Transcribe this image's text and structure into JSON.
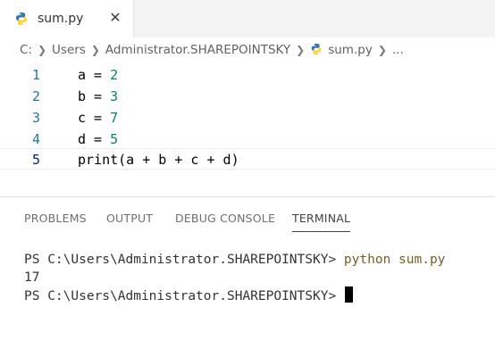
{
  "editor_tab": {
    "filename": "sum.py",
    "icon": "python-icon",
    "close_glyph": "✕"
  },
  "breadcrumb": {
    "parts": [
      "C:",
      "Users",
      "Administrator.SHAREPOINTSKY",
      "sum.py",
      "..."
    ]
  },
  "code": {
    "lines": [
      {
        "number": "1",
        "var": "a",
        "op": " = ",
        "value": "2"
      },
      {
        "number": "2",
        "var": "b",
        "op": " = ",
        "value": "3"
      },
      {
        "number": "3",
        "var": "c",
        "op": " = ",
        "value": "7"
      },
      {
        "number": "4",
        "var": "d",
        "op": " = ",
        "value": "5"
      },
      {
        "number": "5",
        "text": "print(a + b + c + d)"
      }
    ]
  },
  "panel": {
    "tabs": [
      "PROBLEMS",
      "OUTPUT",
      "DEBUG CONSOLE",
      "TERMINAL"
    ],
    "active_tab": "TERMINAL"
  },
  "terminal": {
    "prompt": "PS C:\\Users\\Administrator.SHAREPOINTSKY> ",
    "command": "python sum.py",
    "output": "17"
  },
  "colors": {
    "python_blue": "#3776ab",
    "python_yellow": "#ffd43b",
    "number_green": "#098658",
    "line_number": "#237893",
    "command_brown": "#795e26"
  }
}
